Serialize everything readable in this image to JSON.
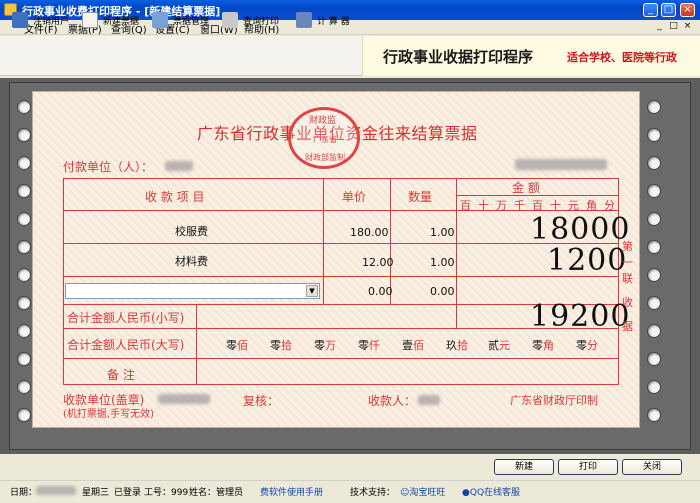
{
  "window": {
    "title": "行政事业收费打印程序 - [新建结算票据]",
    "controls": [
      "_",
      "□",
      "×"
    ],
    "mdi_controls": [
      "_",
      "□",
      "×"
    ]
  },
  "menu": [
    "文件(F)",
    "票据(P)",
    "查询(Q)",
    "设置(C)",
    "窗口(W)",
    "帮助(H)"
  ],
  "toolbar": {
    "items": [
      "注销用户",
      "新建票据",
      "票据管理",
      "查询打印",
      "计 算 器"
    ]
  },
  "banner": {
    "main": "行政事业收据打印程序",
    "sub": "适合学校、医院等行政"
  },
  "ticket": {
    "title": "广东省行政事业单位资金往来结算票据",
    "seal": {
      "top": "财政监",
      "middle": "广东省",
      "bottom": "财政部监制"
    },
    "payer_label": "付款单位（人）：",
    "headers": {
      "item": "收 款 项 目",
      "price": "单价",
      "qty": "数量",
      "amount": "金 额"
    },
    "digit_units": [
      "百",
      "十",
      "万",
      "千",
      "百",
      "十",
      "元",
      "角",
      "分"
    ],
    "rows": [
      {
        "item": "校服费",
        "price": "180.00",
        "qty": "1.00",
        "amount": "18000"
      },
      {
        "item": "材料费",
        "price": "12.00",
        "qty": "1.00",
        "amount": "1200"
      },
      {
        "item": "",
        "price": "0.00",
        "qty": "0.00",
        "amount": ""
      }
    ],
    "total_small_label": "合计金额人民币(小写)",
    "total_small": "19200",
    "total_big_label": "合计金额人民币(大写)",
    "total_big": [
      {
        "v": "零",
        "u": "佰"
      },
      {
        "v": "零",
        "u": "拾"
      },
      {
        "v": "零",
        "u": "万"
      },
      {
        "v": "零",
        "u": "仟"
      },
      {
        "v": "壹",
        "u": "佰"
      },
      {
        "v": "玖",
        "u": "拾"
      },
      {
        "v": "贰",
        "u": "元"
      },
      {
        "v": "零",
        "u": "角"
      },
      {
        "v": "零",
        "u": "分"
      }
    ],
    "remark_label": "备 注",
    "side_label": [
      "第",
      "一",
      "联",
      "收",
      "据"
    ],
    "receiver_label": "收款单位(盖章)",
    "receiver_note": "(机打票据,手写无效)",
    "reviewer_label": "复核：",
    "payee_label": "收款人：",
    "printer": "广东省财政厅印制"
  },
  "buttons": {
    "new": "新建",
    "print": "打印",
    "close": "关闭"
  },
  "status": {
    "date_label": "日期：",
    "weekday": "星期三",
    "logged_in": "已登录",
    "work_id": "工号：999",
    "name": "姓名：管理员",
    "manual": "费软件使用手册",
    "support": "技术支持：",
    "taobao": "淘宝旺旺",
    "qq": "QQ在线客服"
  }
}
